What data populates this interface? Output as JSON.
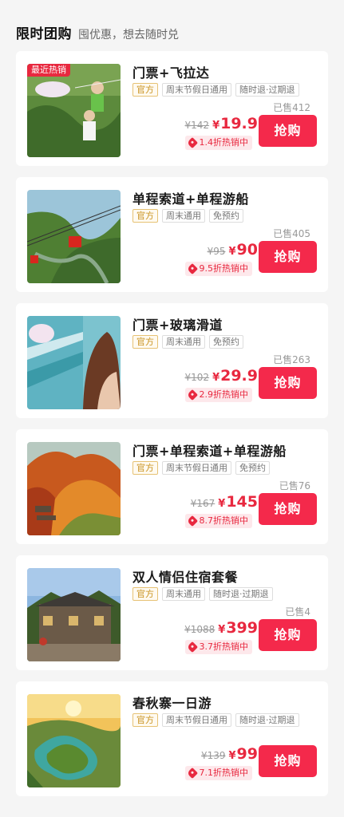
{
  "header": {
    "title": "限时团购",
    "subtitle": "囤优惠，想去随时兑"
  },
  "products": [
    {
      "name": "门票+飞拉达",
      "badge": "最近热销",
      "tags": [
        "官方",
        "周末节假日通用",
        "随时退·过期退"
      ],
      "sold": "已售412",
      "original_price": "¥142",
      "price_symbol": "¥",
      "price": "19.9",
      "discount": "1.4折热销中",
      "buy_label": "抢购"
    },
    {
      "name": "单程索道+单程游船",
      "badge": "",
      "tags": [
        "官方",
        "周末通用",
        "免预约"
      ],
      "sold": "已售405",
      "original_price": "¥95",
      "price_symbol": "¥",
      "price": "90",
      "discount": "9.5折热销中",
      "buy_label": "抢购"
    },
    {
      "name": "门票+玻璃滑道",
      "badge": "",
      "tags": [
        "官方",
        "周末通用",
        "免预约"
      ],
      "sold": "已售263",
      "original_price": "¥102",
      "price_symbol": "¥",
      "price": "29.9",
      "discount": "2.9折热销中",
      "buy_label": "抢购"
    },
    {
      "name": "门票+单程索道+单程游船",
      "badge": "",
      "tags": [
        "官方",
        "周末节假日通用",
        "免预约"
      ],
      "sold": "已售76",
      "original_price": "¥167",
      "price_symbol": "¥",
      "price": "145",
      "discount": "8.7折热销中",
      "buy_label": "抢购"
    },
    {
      "name": "双人情侣住宿套餐",
      "badge": "",
      "tags": [
        "官方",
        "周末通用",
        "随时退·过期退"
      ],
      "sold": "已售4",
      "original_price": "¥1088",
      "price_symbol": "¥",
      "price": "399",
      "discount": "3.7折热销中",
      "buy_label": "抢购"
    },
    {
      "name": "春秋寨一日游",
      "badge": "",
      "tags": [
        "官方",
        "周末节假日通用",
        "随时退·过期退"
      ],
      "sold": "",
      "original_price": "¥139",
      "price_symbol": "¥",
      "price": "99",
      "discount": "7.1折热销中",
      "buy_label": "抢购"
    }
  ],
  "colors": {
    "accent": "#f4294b",
    "official": "#c8921e",
    "background": "#f5f5f5"
  }
}
